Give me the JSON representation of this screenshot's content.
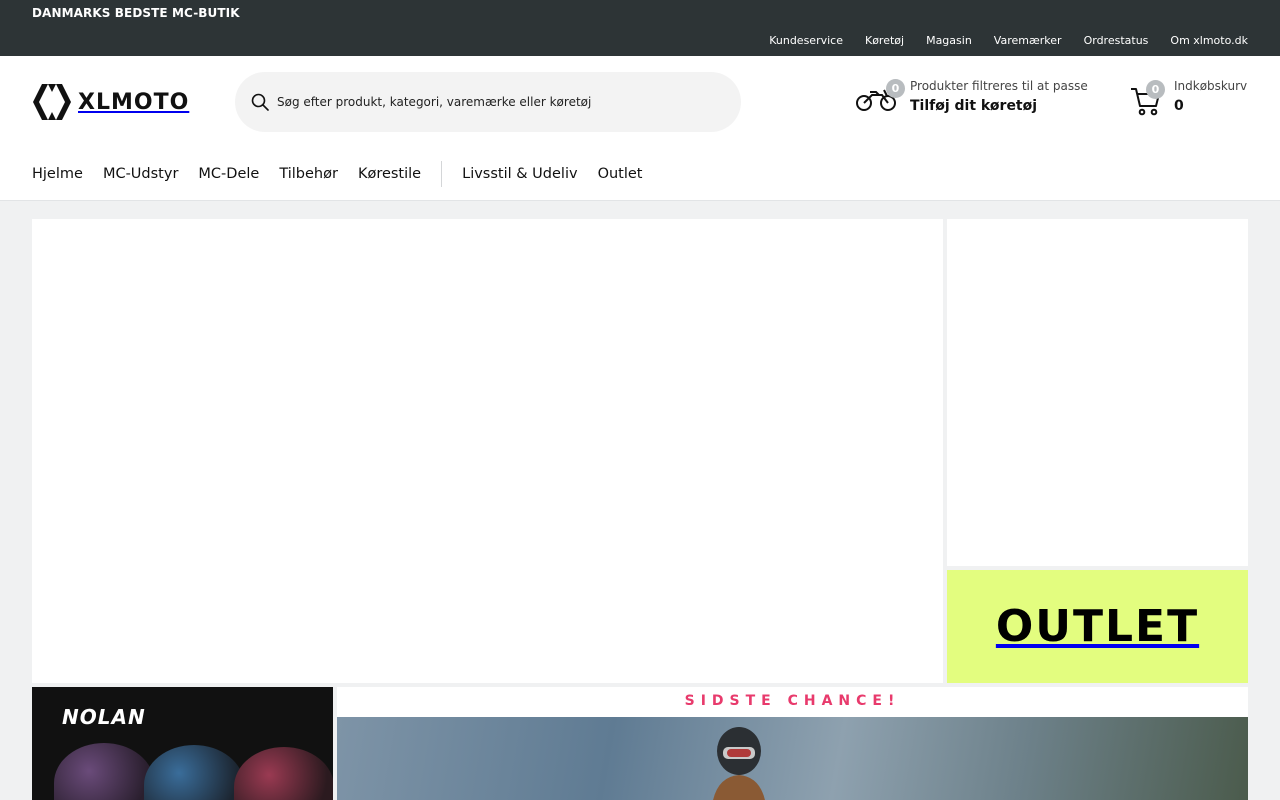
{
  "topbar": {
    "tagline": "DANMARKS BEDSTE MC-BUTIK",
    "links": [
      "Kundeservice",
      "Køretøj",
      "Magasin",
      "Varemærker",
      "Ordrestatus",
      "Om xlmoto.dk"
    ]
  },
  "header": {
    "logo_text": "XLMOTO",
    "search": {
      "placeholder": "Søg efter produkt, kategori, varemærke eller køretøj"
    },
    "vehicle": {
      "badge": "0",
      "subtitle": "Produkter filtreres til at passe",
      "title": "Tilføj dit køretøj"
    },
    "cart": {
      "badge": "0",
      "label": "Indkøbskurv",
      "count": "0"
    }
  },
  "nav": {
    "items": [
      "Hjelme",
      "MC-Udstyr",
      "MC-Dele",
      "Tilbehør",
      "Kørestile"
    ],
    "items_after_sep": [
      "Livsstil & Udeliv",
      "Outlet"
    ]
  },
  "banners": {
    "outlet": "OUTLET",
    "nolan": "NOLAN",
    "last_chance": "SIDSTE CHANCE!"
  },
  "colors": {
    "topbar": "#2d3436",
    "outlet_bg": "#e3fd7f",
    "last_chance_text": "#e83a6c"
  }
}
